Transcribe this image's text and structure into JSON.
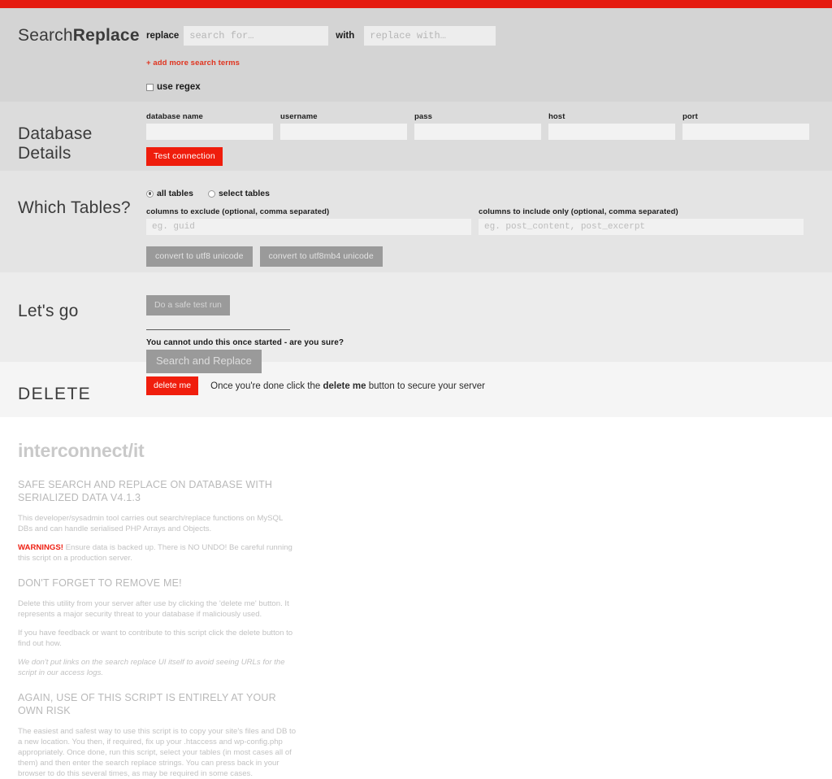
{
  "topbar": {
    "color": "#e51b10"
  },
  "search_section": {
    "title_light": "Search",
    "title_bold": "Replace",
    "replace_label": "replace",
    "search_placeholder": "search for…",
    "with_label": "with",
    "replace_placeholder": "replace with…",
    "add_more_link": "+ add more search terms",
    "regex_label": "use regex",
    "regex_checked": false
  },
  "database_section": {
    "title_line1": "Database",
    "title_line2": "Details",
    "fields": [
      {
        "label": "database name",
        "value": "",
        "name": "database-name-field"
      },
      {
        "label": "username",
        "value": "",
        "name": "username-field"
      },
      {
        "label": "pass",
        "value": "",
        "name": "pass-field"
      },
      {
        "label": "host",
        "value": "",
        "name": "host-field"
      },
      {
        "label": "port",
        "value": "",
        "name": "port-field"
      }
    ],
    "test_button": "Test connection"
  },
  "tables_section": {
    "title": "Which Tables?",
    "radio_all": "all tables",
    "radio_select": "select tables",
    "selected": "all tables",
    "exclude_label": "columns to exclude (optional, comma separated)",
    "exclude_placeholder": "eg. guid",
    "include_label": "columns to include only (optional, comma separated)",
    "include_placeholder": "eg. post_content, post_excerpt",
    "utf8_button": "convert to utf8 unicode",
    "utf8mb4_button": "convert to utf8mb4 unicode"
  },
  "letsgo_section": {
    "title": "Let's go",
    "dry_run_button": "Do a safe test run",
    "confirm_text": "You cannot undo this once started - are you sure?",
    "search_replace_button": "Search and Replace"
  },
  "delete_section": {
    "title": "DELETE",
    "delete_button": "delete me",
    "note_before": "Once you're done click the ",
    "note_bold": "delete me",
    "note_after": " button to secure your server"
  },
  "footer": {
    "brand": "interconnect/it",
    "heading1": "SAFE SEARCH AND REPLACE ON DATABASE WITH SERIALIZED DATA V4.1.3",
    "para1": "This developer/sysadmin tool carries out search/replace functions on MySQL DBs and can handle serialised PHP Arrays and Objects.",
    "warning_strong": "WARNINGS!",
    "warning_rest": " Ensure data is backed up. There is NO UNDO! Be careful running this script on a production server.",
    "heading2": "DON'T FORGET TO REMOVE ME!",
    "para2": "Delete this utility from your server after use by clicking the 'delete me' button. It represents a major security threat to your database if maliciously used.",
    "para3": "If you have feedback or want to contribute to this script click the delete button to find out how.",
    "para4": "We don't put links on the search replace UI itself to avoid seeing URLs for the script in our access logs.",
    "heading3": "AGAIN, USE OF THIS SCRIPT IS ENTIRELY AT YOUR OWN RISK",
    "para5": "The easiest and safest way to use this script is to copy your site's files and DB to a new location. You then, if required, fix up your .htaccess and wp-config.php appropriately. Once done, run this script, select your tables (in most cases all of them) and then enter the search replace strings. You can press back in your browser to do this several times, as may be required in some cases."
  }
}
